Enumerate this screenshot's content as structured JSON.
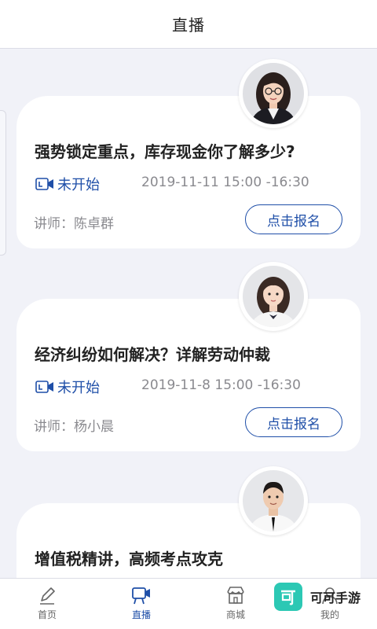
{
  "header": {
    "title": "直播"
  },
  "courses": [
    {
      "title": "强势锁定重点，库存现金你了解多少?",
      "status": "未开始",
      "time": "2019-11-11 15:00 -16:30",
      "lecturer": "讲师：陈卓群",
      "signup_label": "点击报名"
    },
    {
      "title": "经济纠纷如何解决？详解劳动仲裁",
      "status": "未开始",
      "time": "2019-11-8 15:00 -16:30",
      "lecturer": "讲师：杨小晨",
      "signup_label": "点击报名"
    },
    {
      "title": "增值税精讲，高频考点攻克"
    }
  ],
  "tabbar": {
    "items": [
      {
        "label": "首页",
        "icon": "pen-icon"
      },
      {
        "label": "直播",
        "icon": "live-camera-icon",
        "active": true
      },
      {
        "label": "商城",
        "icon": "store-icon"
      },
      {
        "label": "我的",
        "icon": "profile-icon"
      }
    ]
  },
  "watermark": {
    "logo_char": "可",
    "text": "可可手游"
  },
  "colors": {
    "accent": "#1f4fa8",
    "background": "#f1f2f8",
    "card": "#ffffff",
    "muted_text": "#8a8a8f",
    "watermark": "#2cc8b4"
  }
}
